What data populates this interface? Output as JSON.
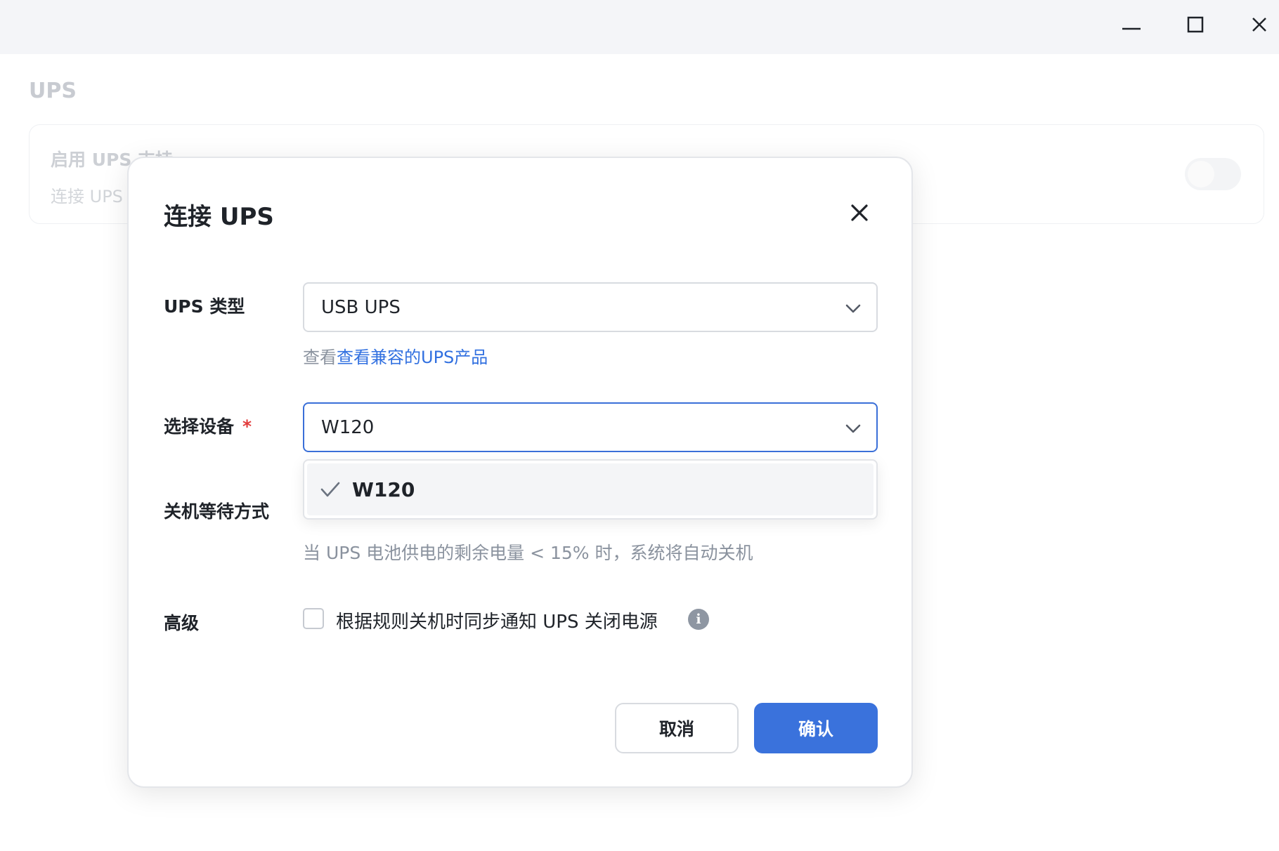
{
  "window": {
    "minimize_icon": "minimize-icon",
    "maximize_icon": "maximize-icon",
    "close_icon": "close-icon"
  },
  "background": {
    "title": "UPS",
    "card_title": "启用 UPS 支持",
    "card_subtitle": "连接 UPS"
  },
  "modal": {
    "title": "连接 UPS",
    "ups_type": {
      "label": "UPS 类型",
      "value": "USB UPS",
      "hint_prefix": "查看",
      "hint_link": "查看兼容的UPS产品"
    },
    "device": {
      "label": "选择设备",
      "required_mark": "*",
      "value": "W120",
      "options": [
        {
          "label": "W120",
          "selected": true
        }
      ]
    },
    "shutdown": {
      "label": "关机等待方式",
      "hint": "当 UPS 电池供电的剩余电量 < 15% 时，系统将自动关机"
    },
    "advanced": {
      "label": "高级",
      "checkbox_label": "根据规则关机时同步通知 UPS 关闭电源",
      "checked": false
    },
    "buttons": {
      "cancel": "取消",
      "confirm": "确认"
    }
  },
  "colors": {
    "primary": "#3a72dc",
    "link": "#3170e0",
    "required": "#e23b3b"
  }
}
